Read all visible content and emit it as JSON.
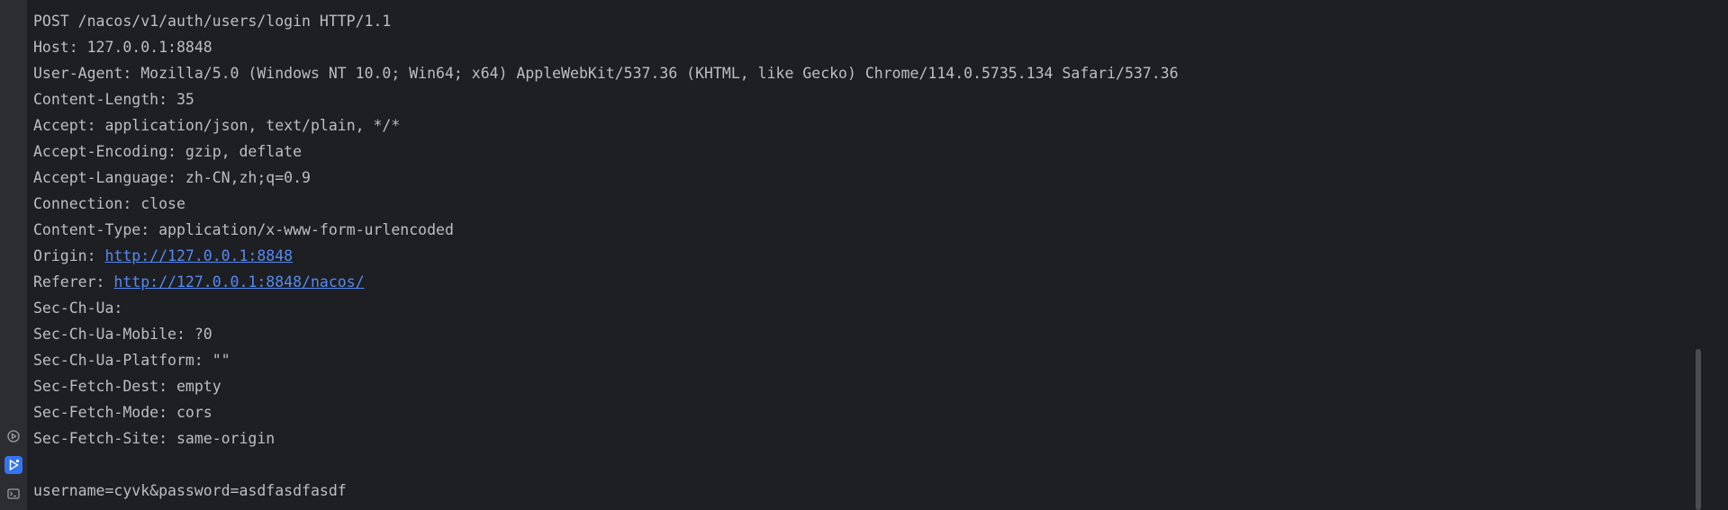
{
  "console": {
    "partial_top_line": "--",
    "request_line": "POST /nacos/v1/auth/users/login HTTP/1.1",
    "headers": [
      {
        "name": "Host:",
        "value": "127.0.0.1:8848"
      },
      {
        "name": "User-Agent:",
        "value": "Mozilla/5.0 (Windows NT 10.0; Win64; x64) AppleWebKit/537.36 (KHTML, like Gecko) Chrome/114.0.5735.134 Safari/537.36"
      },
      {
        "name": "Content-Length:",
        "value": "35"
      },
      {
        "name": "Accept:",
        "value": "application/json, text/plain, */*"
      },
      {
        "name": "Accept-Encoding:",
        "value": "gzip, deflate"
      },
      {
        "name": "Accept-Language:",
        "value": "zh-CN,zh;q=0.9"
      },
      {
        "name": "Connection:",
        "value": "close"
      },
      {
        "name": "Content-Type:",
        "value": "application/x-www-form-urlencoded"
      },
      {
        "name": "Origin:",
        "value": "http://127.0.0.1:8848",
        "link": true
      },
      {
        "name": "Referer:",
        "value": "http://127.0.0.1:8848/nacos/",
        "link": true
      },
      {
        "name": "Sec-Ch-Ua:",
        "value": ""
      },
      {
        "name": "Sec-Ch-Ua-Mobile:",
        "value": "?0"
      },
      {
        "name": "Sec-Ch-Ua-Platform:",
        "value": "\"\""
      },
      {
        "name": "Sec-Fetch-Dest:",
        "value": "empty"
      },
      {
        "name": "Sec-Fetch-Mode:",
        "value": "cors"
      },
      {
        "name": "Sec-Fetch-Site:",
        "value": "same-origin"
      }
    ],
    "body": "username=cyvk&password=asdfasdfasdf"
  },
  "gutter": {
    "icons": [
      "run-debug-icon",
      "run-icon",
      "terminal-icon"
    ]
  },
  "colors": {
    "background": "#1e1f22",
    "text": "#bcbec4",
    "link": "#548af7",
    "active_icon_bg": "#3574f0"
  }
}
